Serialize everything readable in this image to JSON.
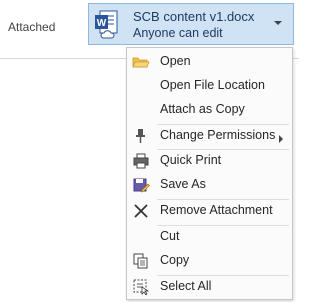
{
  "attached_label": "Attached",
  "attachment": {
    "file_name": "SCB content v1.docx",
    "permission": "Anyone can edit"
  },
  "menu": {
    "items": [
      {
        "label": "Open"
      },
      {
        "label": "Open File Location"
      },
      {
        "label": "Attach as Copy"
      },
      {
        "label": "Change Permissions"
      },
      {
        "label": "Quick Print"
      },
      {
        "label": "Save As"
      },
      {
        "label": "Remove Attachment"
      },
      {
        "label": "Cut"
      },
      {
        "label": "Copy"
      },
      {
        "label": "Select All"
      }
    ]
  }
}
